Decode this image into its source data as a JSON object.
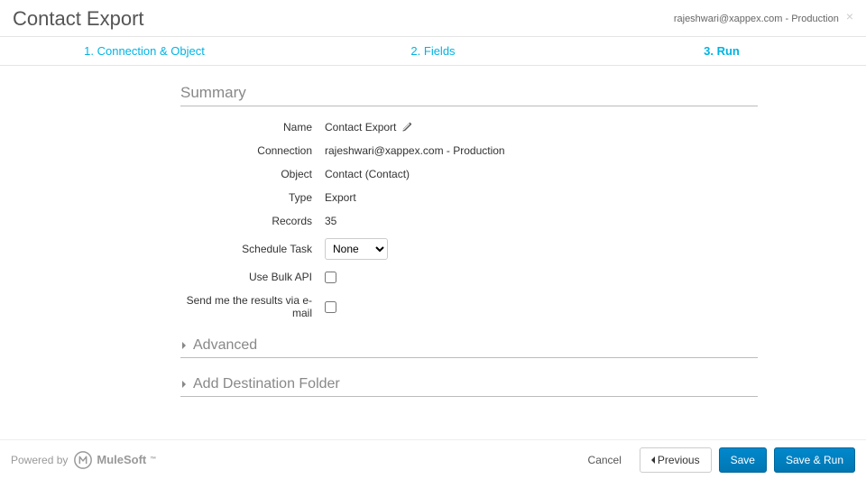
{
  "header": {
    "title": "Contact Export",
    "connection_label": "rajeshwari@xappex.com - Production"
  },
  "tabs": {
    "step1": "1. Connection & Object",
    "step2": "2. Fields",
    "step3": "3. Run"
  },
  "summary": {
    "heading": "Summary",
    "labels": {
      "name": "Name",
      "connection": "Connection",
      "object": "Object",
      "type": "Type",
      "records": "Records",
      "schedule_task": "Schedule Task",
      "use_bulk_api": "Use Bulk API",
      "send_results": "Send me the results via e-mail"
    },
    "values": {
      "name": "Contact Export",
      "connection": "rajeshwari@xappex.com - Production",
      "object": "Contact (Contact)",
      "type": "Export",
      "records": "35",
      "schedule_task_selected": "None",
      "use_bulk_api_checked": false,
      "send_results_checked": false
    },
    "schedule_task_options": [
      "None"
    ]
  },
  "sections": {
    "advanced": "Advanced",
    "add_destination": "Add Destination Folder"
  },
  "footer": {
    "powered_by": "Powered by",
    "brand": "MuleSoft",
    "buttons": {
      "cancel": "Cancel",
      "previous": "Previous",
      "save": "Save",
      "save_run": "Save & Run"
    }
  }
}
